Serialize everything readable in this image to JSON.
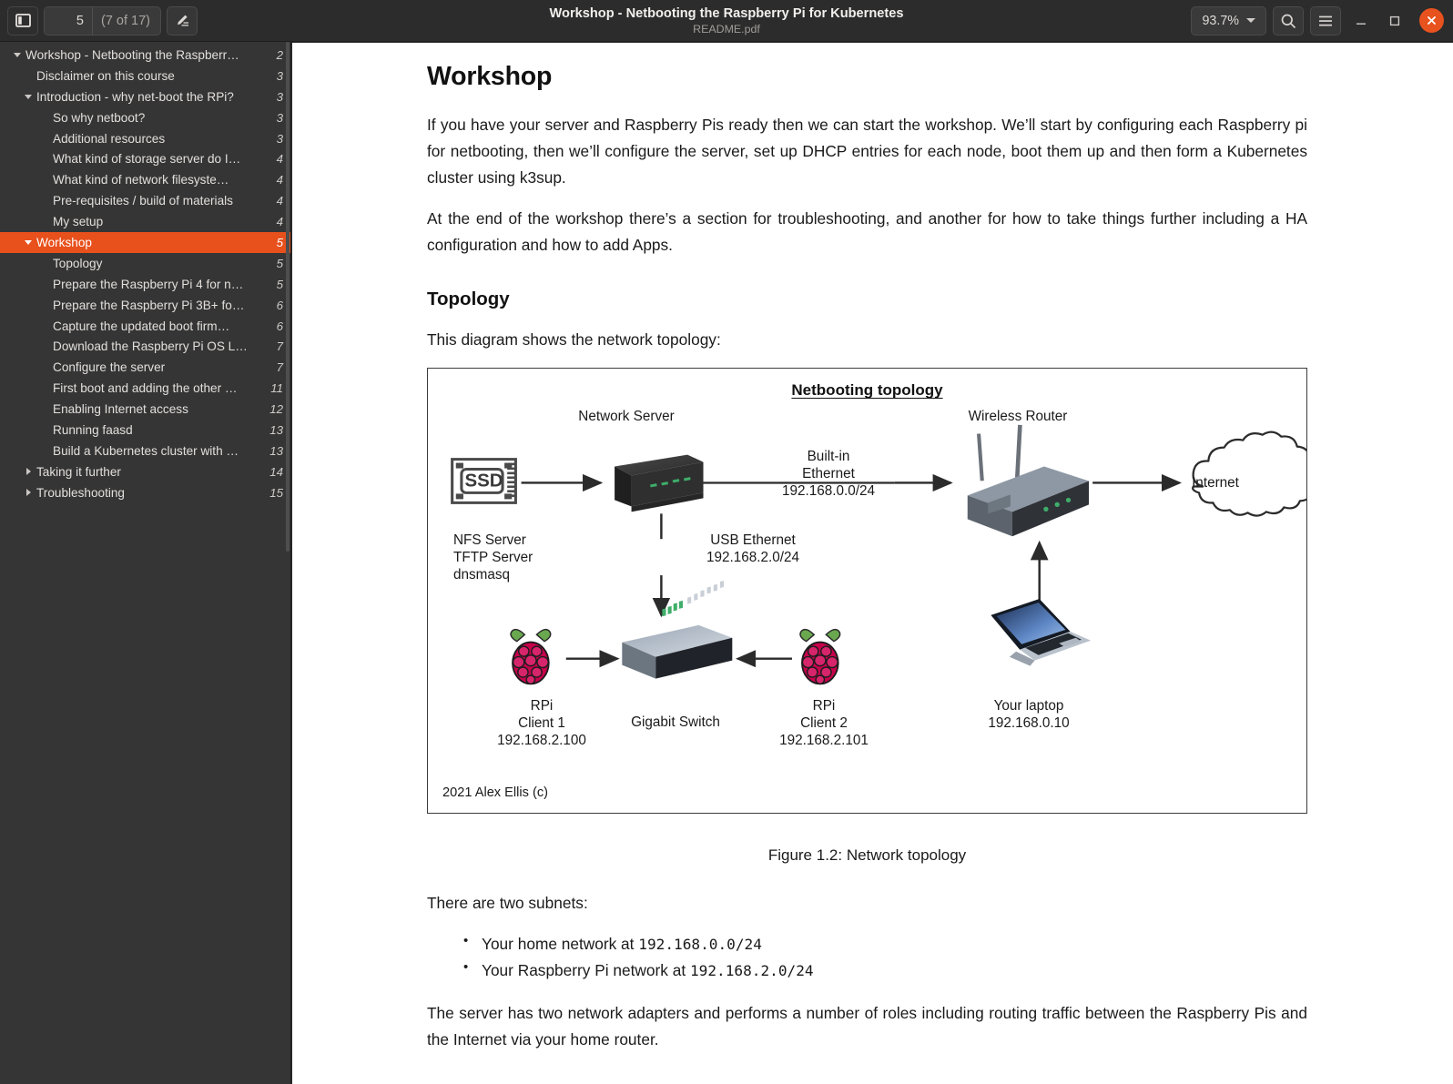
{
  "window": {
    "title": "Workshop - Netbooting the Raspberry Pi for Kubernetes",
    "subtitle": "README.pdf",
    "accent_color": "#e8501c",
    "titlebar_bg": "#2c2c2c",
    "sidebar_bg": "#353535"
  },
  "toolbar": {
    "sidebar_toggle_icon": "sidebar-panel-icon",
    "page_number": "5",
    "page_total": "(7 of 17)",
    "annotate_icon": "pen-annotate-icon",
    "zoom_level": "93.7%",
    "search_icon": "search-icon",
    "menu_icon": "hamburger-menu-icon",
    "minimize_icon": "minimize-icon",
    "maximize_icon": "maximize-icon",
    "close_icon": "close-icon"
  },
  "sidebar": {
    "items": [
      {
        "label": "Workshop - Netbooting the Raspberr…",
        "page": "2",
        "indent": 0,
        "twisty": "down",
        "selected": false
      },
      {
        "label": "Disclaimer on this course",
        "page": "3",
        "indent": 1,
        "twisty": "none",
        "selected": false
      },
      {
        "label": "Introduction - why net-boot the RPi?",
        "page": "3",
        "indent": 1,
        "twisty": "down",
        "selected": false
      },
      {
        "label": "So why netboot?",
        "page": "3",
        "indent": 2,
        "twisty": "none",
        "selected": false
      },
      {
        "label": "Additional resources",
        "page": "3",
        "indent": 2,
        "twisty": "none",
        "selected": false
      },
      {
        "label": "What kind of storage server do I…",
        "page": "4",
        "indent": 2,
        "twisty": "none",
        "selected": false
      },
      {
        "label": "What kind of network filesyste…",
        "page": "4",
        "indent": 2,
        "twisty": "none",
        "selected": false
      },
      {
        "label": "Pre-requisites / build of materials",
        "page": "4",
        "indent": 2,
        "twisty": "none",
        "selected": false
      },
      {
        "label": "My setup",
        "page": "4",
        "indent": 2,
        "twisty": "none",
        "selected": false
      },
      {
        "label": "Workshop",
        "page": "5",
        "indent": 1,
        "twisty": "down",
        "selected": true
      },
      {
        "label": "Topology",
        "page": "5",
        "indent": 2,
        "twisty": "none",
        "selected": false
      },
      {
        "label": "Prepare the Raspberry Pi 4 for n…",
        "page": "5",
        "indent": 2,
        "twisty": "none",
        "selected": false
      },
      {
        "label": "Prepare the Raspberry Pi 3B+ fo…",
        "page": "6",
        "indent": 2,
        "twisty": "none",
        "selected": false
      },
      {
        "label": "Capture the updated boot firm…",
        "page": "6",
        "indent": 2,
        "twisty": "none",
        "selected": false
      },
      {
        "label": "Download the Raspberry Pi OS L…",
        "page": "7",
        "indent": 2,
        "twisty": "none",
        "selected": false
      },
      {
        "label": "Configure the server",
        "page": "7",
        "indent": 2,
        "twisty": "none",
        "selected": false
      },
      {
        "label": "First boot and adding the other …",
        "page": "11",
        "indent": 2,
        "twisty": "none",
        "selected": false
      },
      {
        "label": "Enabling Internet access",
        "page": "12",
        "indent": 2,
        "twisty": "none",
        "selected": false
      },
      {
        "label": "Running faasd",
        "page": "13",
        "indent": 2,
        "twisty": "none",
        "selected": false
      },
      {
        "label": "Build a Kubernetes cluster with …",
        "page": "13",
        "indent": 2,
        "twisty": "none",
        "selected": false
      },
      {
        "label": "Taking it further",
        "page": "14",
        "indent": 1,
        "twisty": "right",
        "selected": false
      },
      {
        "label": "Troubleshooting",
        "page": "15",
        "indent": 1,
        "twisty": "right",
        "selected": false
      }
    ]
  },
  "document": {
    "heading": "Workshop",
    "para1": "If you have your server and Raspberry Pis ready then we can start the workshop. We’ll start by configuring each Raspberry pi for netbooting, then we’ll configure the server, set up DHCP entries for each node, boot them up and then form a Kubernetes cluster using k3sup.",
    "para2": "At the end of the workshop there’s a section for troubleshooting, and another for how to take things further including a HA configuration and how to add Apps.",
    "subheading": "Topology",
    "para3": "This diagram shows the network topology:",
    "figure_caption": "Figure 1.2: Network topology",
    "para4": "There are two subnets:",
    "bullets": [
      {
        "text": "Your home network at ",
        "code": "192.168.0.0/24"
      },
      {
        "text": "Your Raspberry Pi network at ",
        "code": "192.168.2.0/24"
      }
    ],
    "para5": "The server has two network adapters and performs a number of roles including routing traffic between the Raspberry Pis and the Internet via your home router."
  },
  "diagram": {
    "title": "Netbooting topology",
    "copyright": "2021 Alex Ellis (c)",
    "nodes": [
      {
        "name": "ssd-storage",
        "label": "SSD",
        "sublabel": "NFS Server\nTFTP Server\ndnsmasq"
      },
      {
        "name": "network-server",
        "label": "Network Server",
        "sublabel": ""
      },
      {
        "name": "wireless-router",
        "label": "Wireless Router",
        "sublabel": ""
      },
      {
        "name": "internet-cloud",
        "label": "Internet",
        "sublabel": ""
      },
      {
        "name": "rpi-client-1",
        "label": "RPi\nClient 1\n192.168.2.100",
        "sublabel": ""
      },
      {
        "name": "gigabit-switch",
        "label": "Gigabit Switch",
        "sublabel": ""
      },
      {
        "name": "rpi-client-2",
        "label": "RPi\nClient 2\n192.168.2.101",
        "sublabel": ""
      },
      {
        "name": "your-laptop",
        "label": "Your laptop\n192.168.0.10",
        "sublabel": ""
      }
    ],
    "link_labels": [
      {
        "name": "builtin-ethernet-label",
        "text": "Built-in\nEthernet\n192.168.0.0/24"
      },
      {
        "name": "usb-ethernet-label",
        "text": "USB Ethernet\n192.168.2.0/24"
      }
    ]
  }
}
